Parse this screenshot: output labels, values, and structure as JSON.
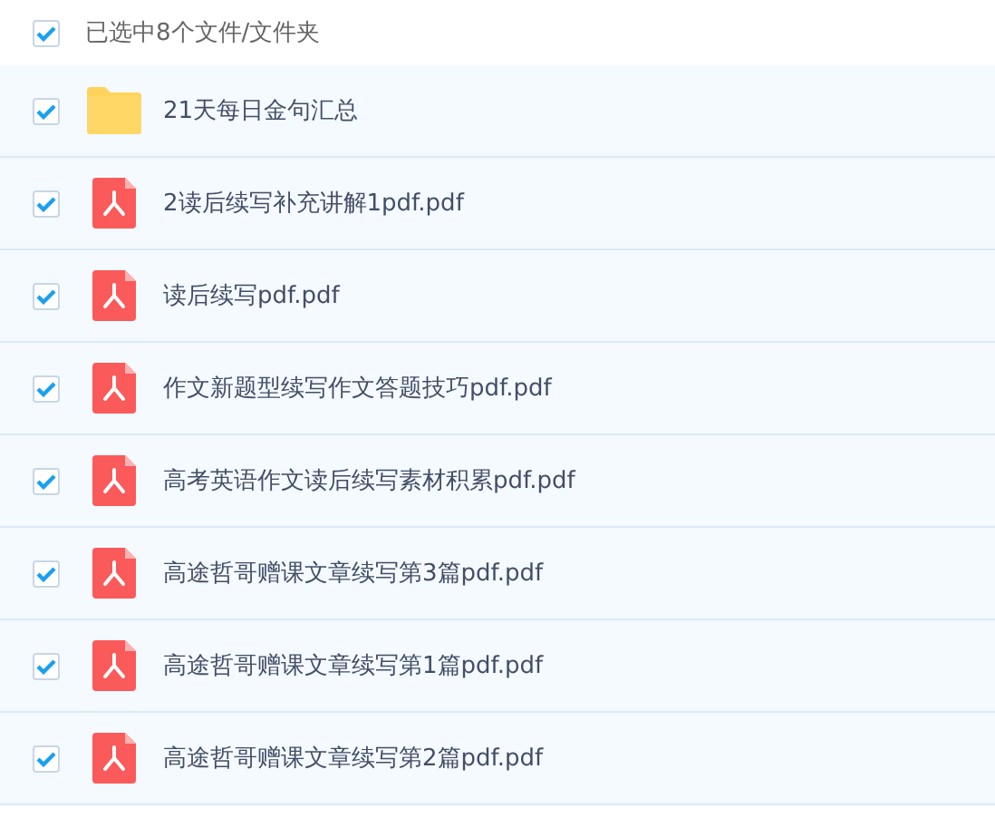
{
  "header": {
    "checked": true,
    "label": "已选中8个文件/文件夹"
  },
  "files": [
    {
      "kind": "folder",
      "name": "21天每日金句汇总",
      "checked": true
    },
    {
      "kind": "pdf",
      "name": "2读后续写补充讲解1pdf.pdf",
      "checked": true
    },
    {
      "kind": "pdf",
      "name": "读后续写pdf.pdf",
      "checked": true
    },
    {
      "kind": "pdf",
      "name": "作文新题型续写作文答题技巧pdf.pdf",
      "checked": true
    },
    {
      "kind": "pdf",
      "name": "高考英语作文读后续写素材积累pdf.pdf",
      "checked": true
    },
    {
      "kind": "pdf",
      "name": "高途哲哥赠课文章续写第3篇pdf.pdf",
      "checked": true
    },
    {
      "kind": "pdf",
      "name": "高途哲哥赠课文章续写第1篇pdf.pdf",
      "checked": true
    },
    {
      "kind": "pdf",
      "name": "高途哲哥赠课文章续写第2篇pdf.pdf",
      "checked": true
    }
  ]
}
